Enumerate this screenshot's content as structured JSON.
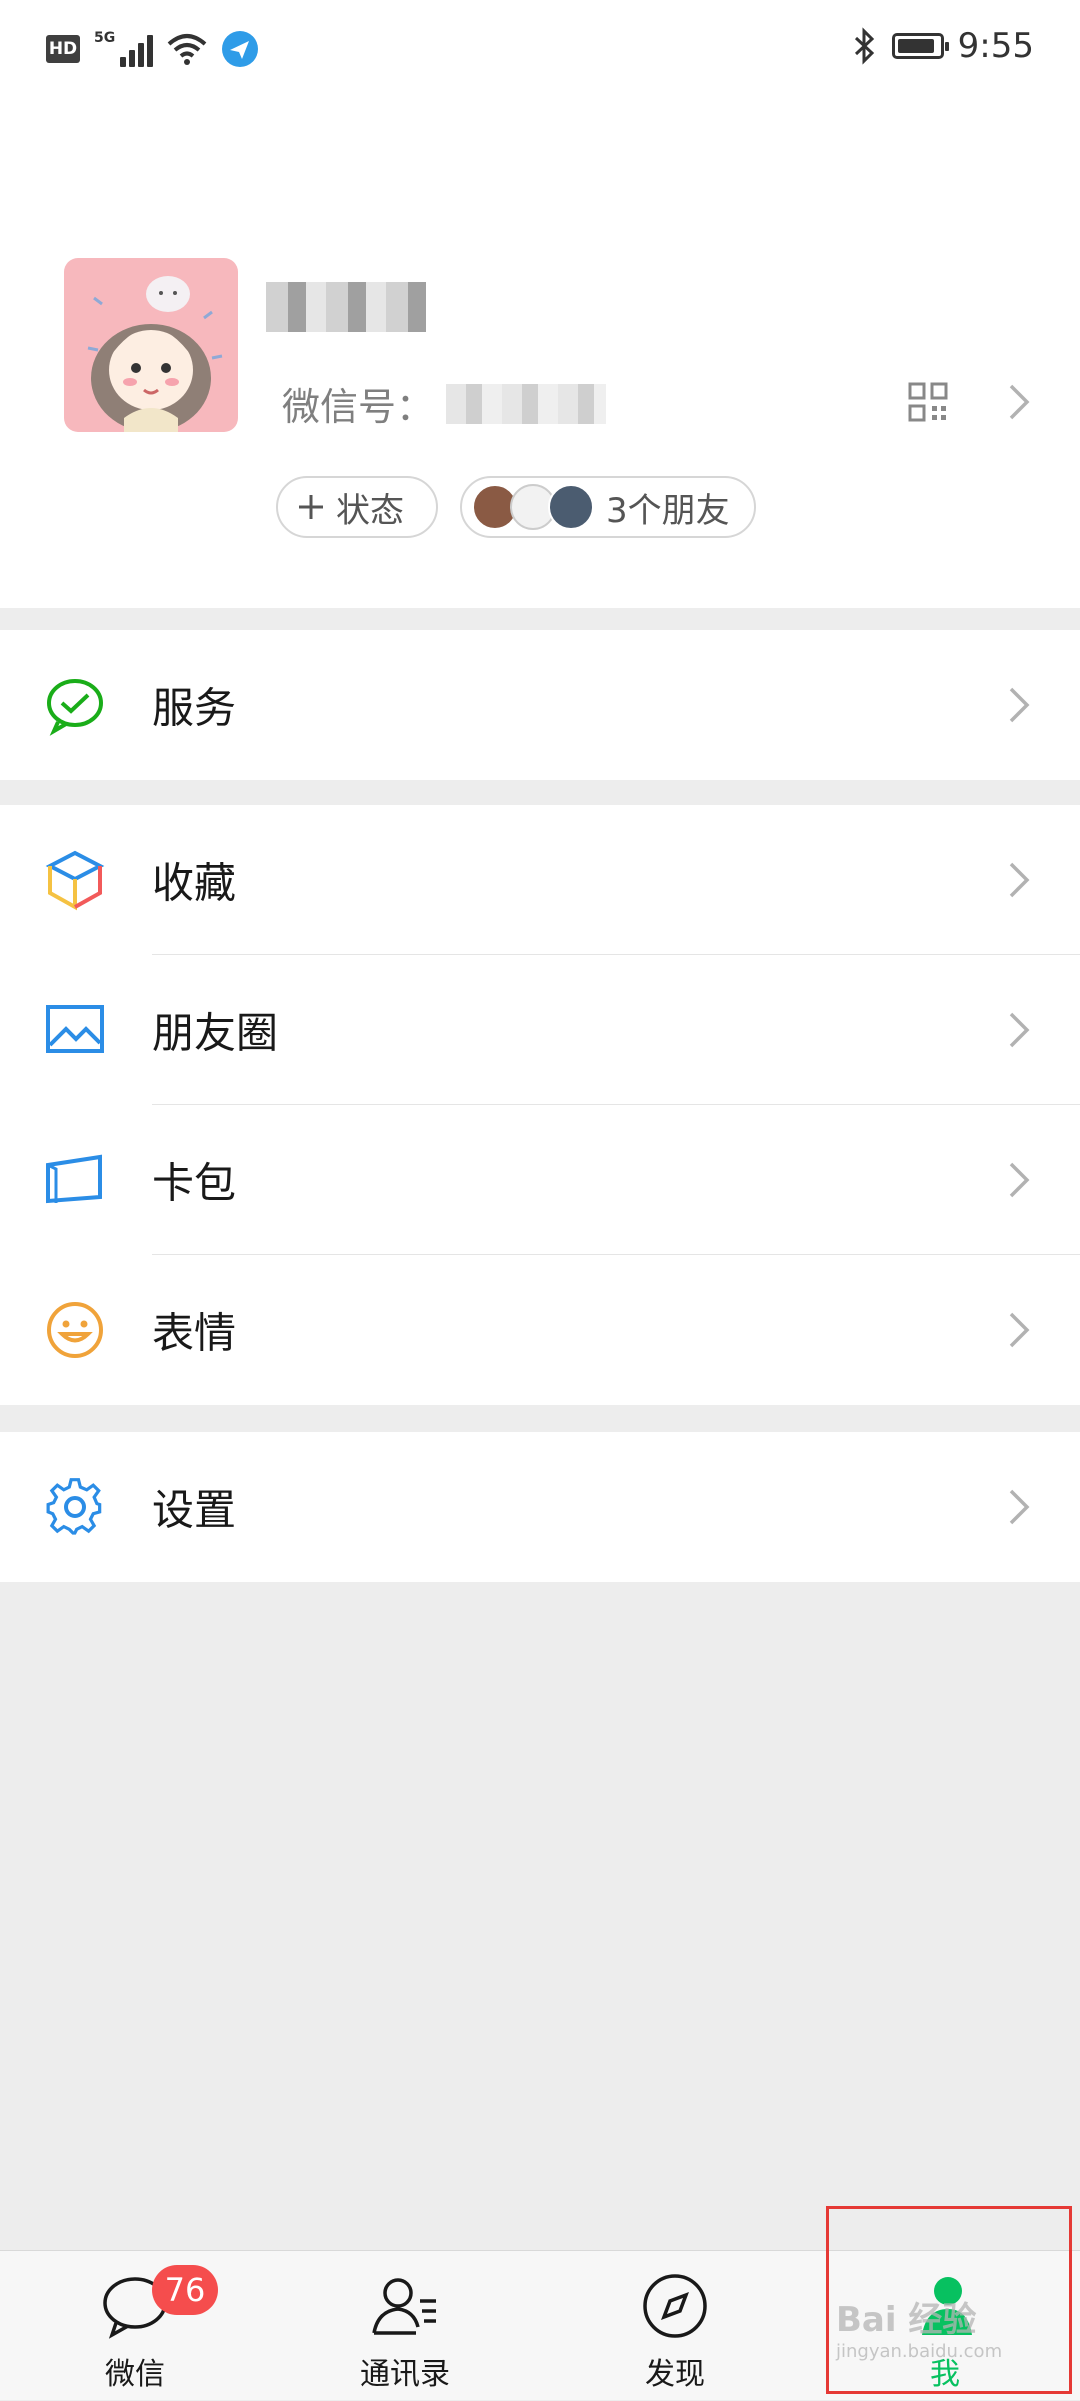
{
  "status_bar": {
    "hd": "HD",
    "network": "5G",
    "time": "9:55",
    "battery_level": 0.9
  },
  "profile": {
    "wxid_label": "微信号：",
    "status_chip": "状态",
    "friends_chip": "3个朋友"
  },
  "menu": {
    "services": "服务",
    "favorites": "收藏",
    "moments": "朋友圈",
    "cards": "卡包",
    "stickers": "表情",
    "settings": "设置"
  },
  "tabs": [
    {
      "label": "微信",
      "icon": "chat-bubble-icon",
      "badge": "76"
    },
    {
      "label": "通讯录",
      "icon": "contacts-icon"
    },
    {
      "label": "发现",
      "icon": "compass-icon"
    },
    {
      "label": "我",
      "icon": "person-icon",
      "active": true
    }
  ],
  "colors": {
    "accent_green": "#07c160",
    "badge_red": "#f54d4d",
    "background": "#ededed"
  },
  "watermark": {
    "text": "Bai 经验",
    "url": "jingyan.baidu.com"
  }
}
